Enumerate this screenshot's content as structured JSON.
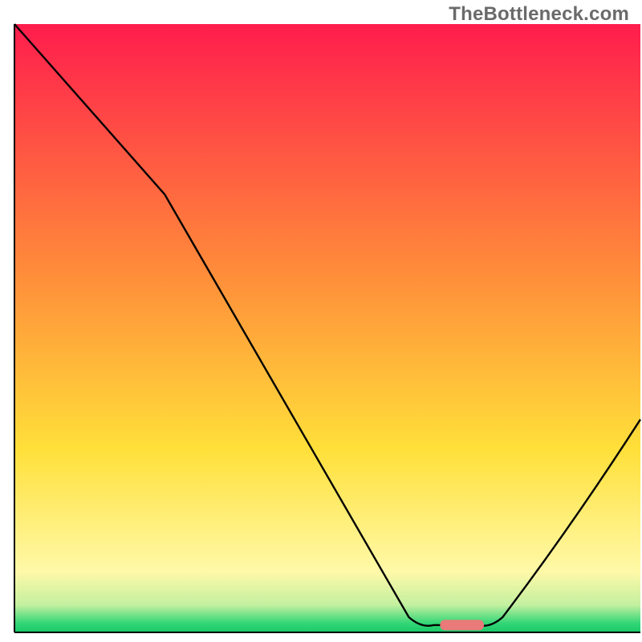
{
  "watermark": "TheBottleneck.com",
  "chart_data": {
    "type": "line",
    "title": "",
    "xlabel": "",
    "ylabel": "",
    "x_range": [
      0,
      100
    ],
    "y_range": [
      0,
      100
    ],
    "grid": false,
    "legend": false,
    "background_gradient": {
      "stops": [
        {
          "offset": 0.0,
          "color": "#ff1d4d"
        },
        {
          "offset": 0.4,
          "color": "#ff8a3a"
        },
        {
          "offset": 0.7,
          "color": "#ffe03a"
        },
        {
          "offset": 0.9,
          "color": "#fff9a8"
        },
        {
          "offset": 0.955,
          "color": "#c3f0a0"
        },
        {
          "offset": 0.985,
          "color": "#33d676"
        },
        {
          "offset": 1.0,
          "color": "#18c968"
        }
      ]
    },
    "series": [
      {
        "name": "curve",
        "type": "line",
        "points": [
          {
            "x": 0,
            "y": 100
          },
          {
            "x": 24,
            "y": 72
          },
          {
            "x": 63,
            "y": 2.5
          },
          {
            "x": 67,
            "y": 1.2
          },
          {
            "x": 74,
            "y": 1.2
          },
          {
            "x": 78,
            "y": 2.5
          },
          {
            "x": 100,
            "y": 35
          }
        ]
      }
    ],
    "highlight_segment": {
      "x_start": 68,
      "x_end": 75,
      "y": 1.2,
      "color": "#e97a79"
    },
    "axes": {
      "left": {
        "x": 2,
        "y1": 0,
        "y2": 100
      },
      "bottom": {
        "y": 0,
        "x1": 0,
        "x2": 100
      }
    }
  }
}
